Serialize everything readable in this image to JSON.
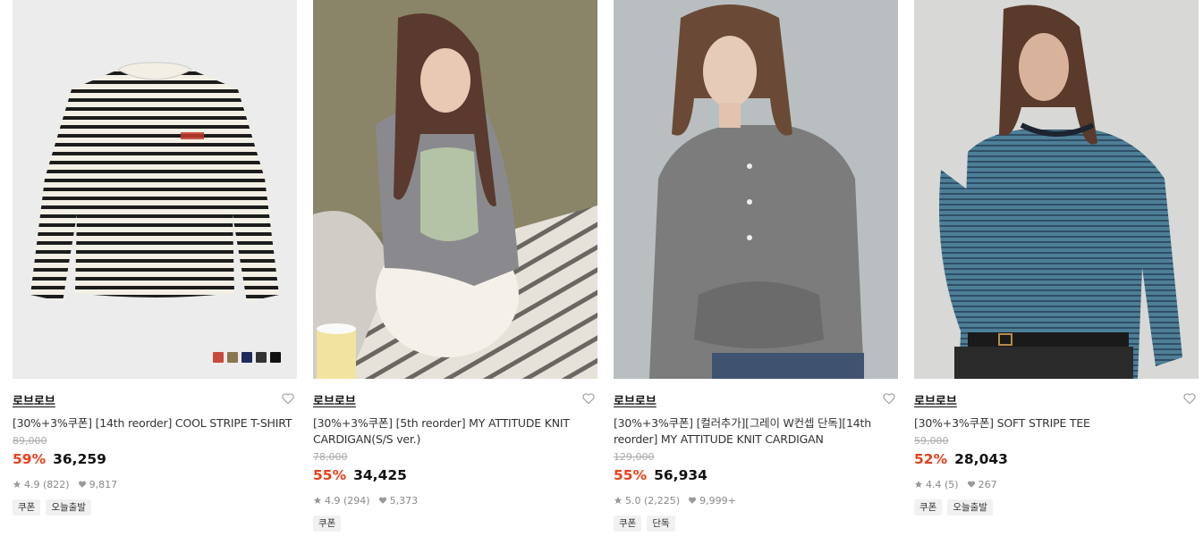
{
  "products": [
    {
      "brand": "로브로브",
      "title": "[30%+3%쿠폰] [14th reorder] COOL STRIPE T-SHIRT",
      "original_price": "89,000",
      "discount": "59%",
      "price": "36,259",
      "rating": "4.9 (822)",
      "likes": "9,817",
      "tags": [
        "쿠폰",
        "오늘출발"
      ],
      "swatches": [
        "#c84a3c",
        "#8a7650",
        "#1f2a5c",
        "#333333",
        "#111111"
      ]
    },
    {
      "brand": "로브로브",
      "title": "[30%+3%쿠폰] [5th reorder] MY ATTITUDE KNIT CARDIGAN(S/S ver.)",
      "original_price": "78,000",
      "discount": "55%",
      "price": "34,425",
      "rating": "4.9 (294)",
      "likes": "5,373",
      "tags": [
        "쿠폰"
      ]
    },
    {
      "brand": "로브로브",
      "title": "[30%+3%쿠폰] [컬러추가][그레이 W컨셉 단독][14th reorder] MY ATTITUDE KNIT CARDIGAN",
      "original_price": "129,000",
      "discount": "55%",
      "price": "56,934",
      "rating": "5.0 (2,225)",
      "likes": "9,999+",
      "tags": [
        "쿠폰",
        "단독"
      ]
    },
    {
      "brand": "로브로브",
      "title": "[30%+3%쿠폰] SOFT STRIPE TEE",
      "original_price": "59,000",
      "discount": "52%",
      "price": "28,043",
      "rating": "4.4 (5)",
      "likes": "267",
      "tags": [
        "쿠폰",
        "오늘출발"
      ]
    }
  ],
  "icons": {
    "wishlist": "heart-outline-icon",
    "rating": "star-icon",
    "likes": "heart-filled-icon"
  },
  "colors": {
    "discount": "#e8401c",
    "price": "#111111",
    "muted": "#888888"
  }
}
